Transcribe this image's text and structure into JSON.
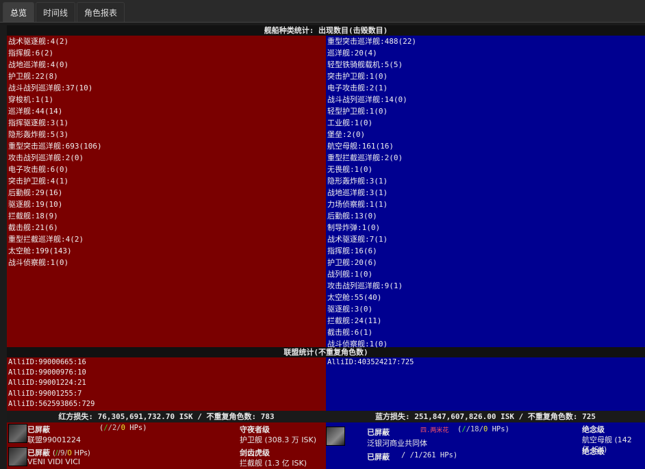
{
  "tabs": [
    "总览",
    "时间线",
    "角色报表"
  ],
  "ship_header": "舰船种类统计: 出现数目(击毁数目)",
  "red_ships": [
    "战术驱逐舰:4(2)",
    "指挥舰:6(2)",
    "战地巡洋舰:4(0)",
    "护卫舰:22(8)",
    "战斗战列巡洋舰:37(10)",
    "穿梭机:1(1)",
    "巡洋舰:44(14)",
    "指挥驱逐舰:3(1)",
    "隐形轰炸舰:5(3)",
    "重型突击巡洋舰:693(106)",
    "攻击战列巡洋舰:2(0)",
    "电子攻击舰:6(0)",
    "突击护卫舰:4(1)",
    "后勤舰:29(16)",
    "驱逐舰:19(10)",
    "拦截舰:18(9)",
    "截击舰:21(6)",
    "重型拦截巡洋舰:4(2)",
    "太空舱:199(143)",
    "战斗侦察舰:1(0)"
  ],
  "blue_ships": [
    "重型突击巡洋舰:488(22)",
    "巡洋舰:20(4)",
    "轻型铁骑舰载机:5(5)",
    "突击护卫舰:1(0)",
    "电子攻击舰:2(1)",
    "战斗战列巡洋舰:14(0)",
    "轻型护卫舰:1(0)",
    "工业舰:1(0)",
    "堡垒:2(0)",
    "航空母舰:161(16)",
    "重型拦截巡洋舰:2(0)",
    "无畏舰:1(0)",
    "隐形轰炸舰:3(1)",
    "战地巡洋舰:3(1)",
    "力场侦察舰:1(1)",
    "后勤舰:13(0)",
    "制导炸弹:1(0)",
    "战术驱逐舰:7(1)",
    "指挥舰:16(6)",
    "护卫舰:20(6)",
    "战列舰:1(0)",
    "攻击战列巡洋舰:9(1)",
    "太空舱:55(40)",
    "驱逐舰:3(0)",
    "拦截舰:24(11)",
    "截击舰:6(1)",
    "战斗侦察舰:1(0)"
  ],
  "alliance_header": "联盟统计(不重复角色数)",
  "red_alliances": [
    "AlliID:99000665:16",
    "AlliID:99000976:10",
    "AlliID:99001224:21",
    "AlliID:99001255:7",
    "AlliID:562593865:729"
  ],
  "blue_alliances": [
    "AlliID:403524217:725"
  ],
  "red_loss": "红方损失: 76,305,691,732.70 ISK / 不重复角色数: 783",
  "blue_loss": "蓝方损失: 251,847,607,826.00 ISK / 不重复角色数: 725",
  "red_pilots": [
    {
      "name": "已屏蔽",
      "sub": "联盟99001224",
      "hp_a": "/",
      "hp_b": "/2/",
      "hp_c": "0",
      "hp_d": " HPs)",
      "ship_class": "守夜者级",
      "ship_val": "护卫舰 (308.3 万 ISK)"
    },
    {
      "name": "已屏蔽",
      "sub": "VENI VIDI VICI",
      "hp_a": "/",
      "hp_b": "/9/",
      "hp_c": "0",
      "hp_d": " HPs)",
      "ship_class": "剑齿虎级",
      "ship_val": "拦截舰 (1.3 亿 ISK)"
    }
  ],
  "blue_pilots": [
    {
      "name": "已屏蔽",
      "tag": "四.两米花",
      "sub": "泛银河商业共同体",
      "hp_a": "/",
      "hp_b": "/18/",
      "hp_c": "0",
      "hp_d": " HPs)",
      "ship_class": "绝念级",
      "ship_val": "航空母舰 (142",
      "ship_val2": "亿 ISK)"
    },
    {
      "name": "已屏蔽",
      "hp_frag": "/ /1/261 HPs)",
      "ship_class": "绝念级"
    }
  ]
}
